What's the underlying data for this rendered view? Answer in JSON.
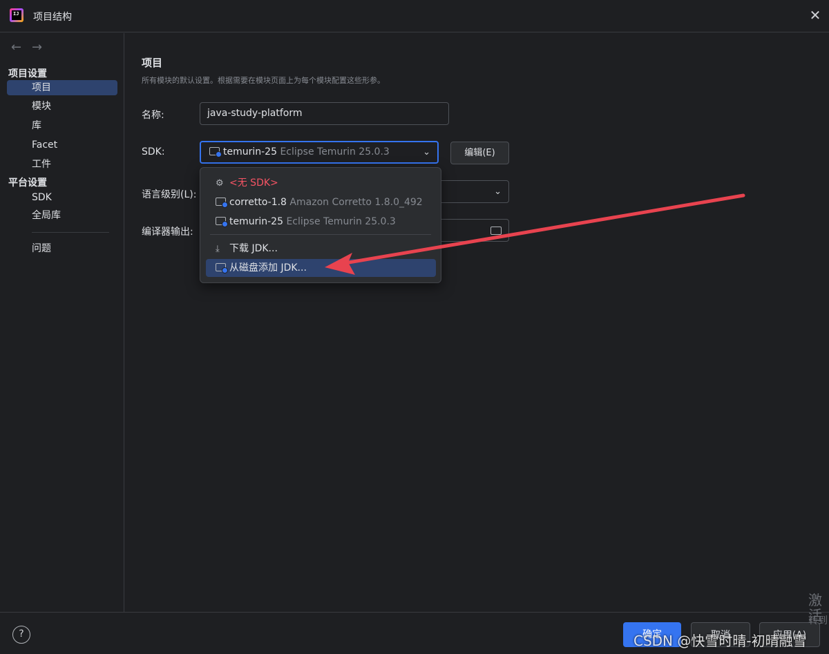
{
  "window": {
    "title": "项目结构",
    "close": "✕"
  },
  "nav": {
    "back": "←",
    "forward": "→"
  },
  "sidebar": {
    "project_settings_title": "项目设置",
    "project_settings_items": [
      "项目",
      "模块",
      "库",
      "Facet",
      "工件"
    ],
    "platform_settings_title": "平台设置",
    "platform_settings_items": [
      "SDK",
      "全局库"
    ],
    "problems": "问题"
  },
  "main": {
    "title": "项目",
    "description": "所有模块的默认设置。根据需要在模块页面上为每个模块配置这些形参。",
    "name_label": "名称:",
    "name_value": "java-study-platform",
    "sdk_label": "SDK:",
    "sdk_selected_name": "temurin-25",
    "sdk_selected_detail": "Eclipse Temurin 25.0.3",
    "edit_button": "编辑(E)",
    "language_level_label": "语言级别(L):",
    "compiler_output_label": "编译器输出:"
  },
  "sdk_dropdown": {
    "no_sdk": "<无 SDK>",
    "items": [
      {
        "name": "corretto-1.8",
        "detail": "Amazon Corretto 1.8.0_492"
      },
      {
        "name": "temurin-25",
        "detail": "Eclipse Temurin 25.0.3"
      }
    ],
    "download_jdk": "下载 JDK...",
    "add_jdk_from_disk": "从磁盘添加 JDK..."
  },
  "footer": {
    "help": "?",
    "ok": "确定",
    "cancel": "取消",
    "apply": "应用(A)"
  },
  "overlay": {
    "watermark": "CSDN @快雪时晴-初晴融雪",
    "activation_title": "激活",
    "activation_sub": "转到"
  },
  "colors": {
    "accent": "#3574f0",
    "selection": "#2e436e",
    "annotation_arrow": "#e8434f",
    "no_sdk_text": "#f75464"
  }
}
